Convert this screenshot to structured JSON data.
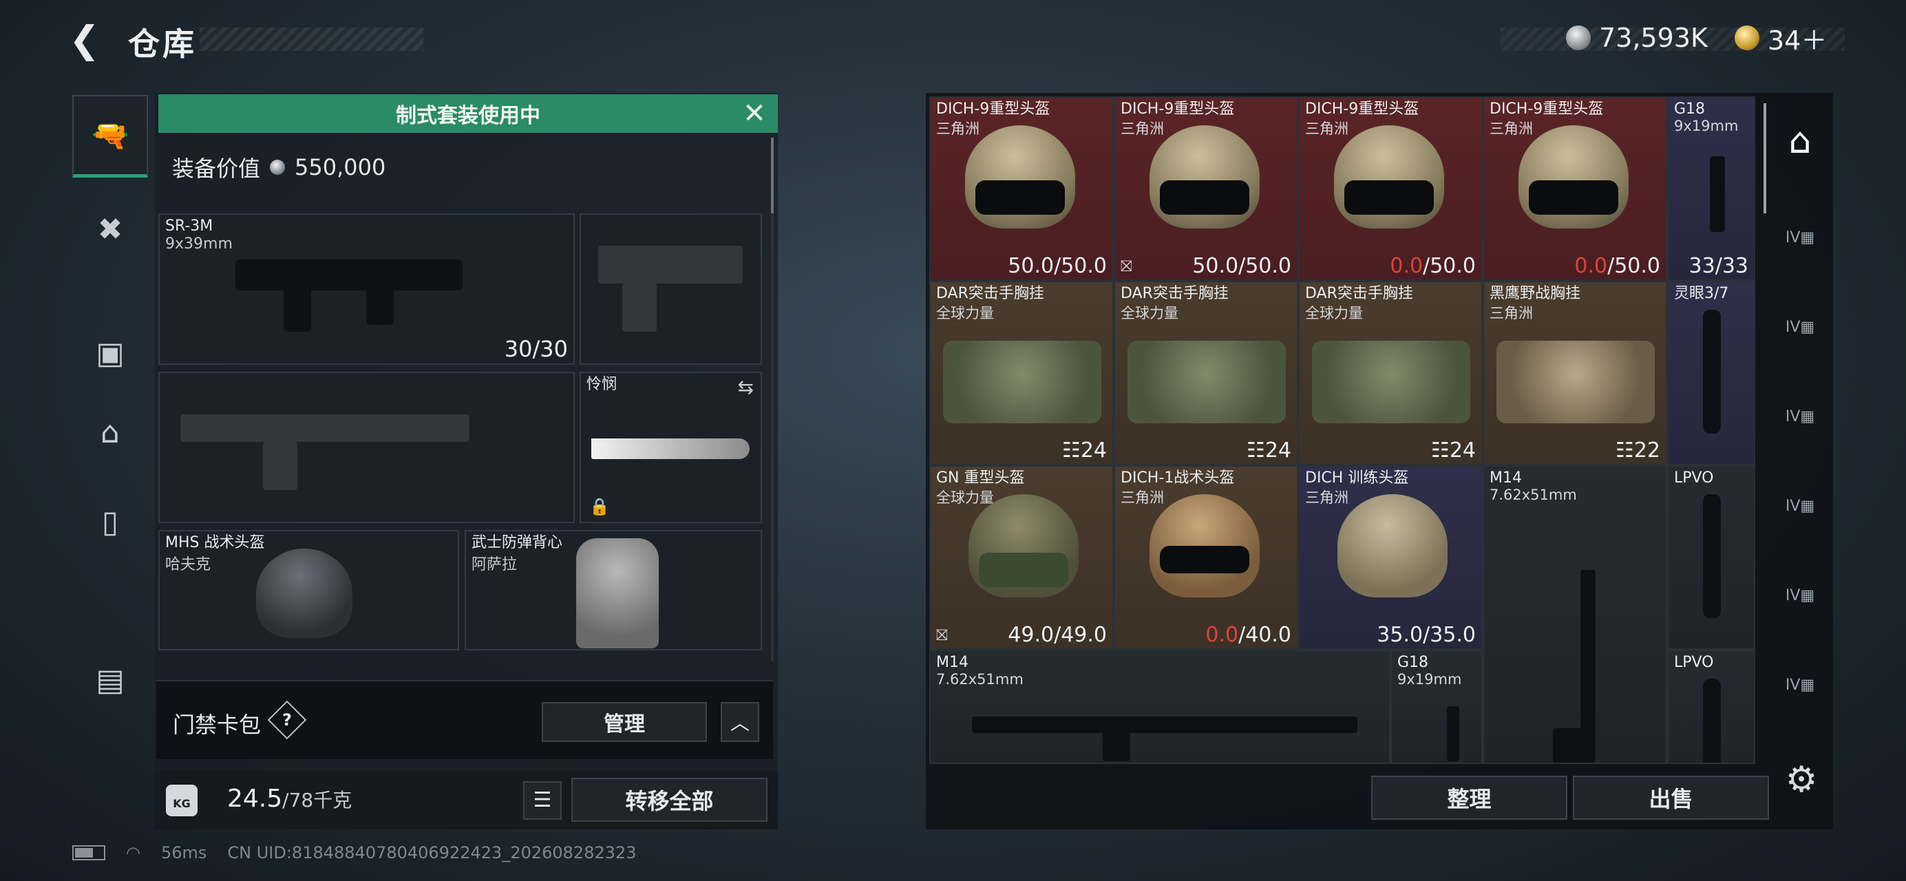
{
  "header": {
    "back_icon": "back-arrow-icon",
    "title": "仓库",
    "silver_amount": "73,593K",
    "gold_amount": "34＋"
  },
  "left_rail": {
    "items": [
      "pistol-icon",
      "vest-icon",
      "backpack-icon",
      "bag-icon",
      "case-icon",
      "toolbox-icon"
    ]
  },
  "loadout": {
    "banner_text": "制式套装使用中",
    "value_label": "装备价值",
    "value_amount": "550,000",
    "primary": {
      "name": "SR-3M",
      "caliber": "9x39mm",
      "ammo": "30/30"
    },
    "melee": {
      "name": "怜悯"
    },
    "helmet": {
      "name": "MHS 战术头盔",
      "maker": "哈夫克"
    },
    "armor": {
      "name": "武士防弹背心",
      "maker": "阿萨拉"
    },
    "keycard_label": "门禁卡包",
    "help_label": "?",
    "manage_label": "管理",
    "collapse_label": "︿"
  },
  "weight": {
    "icon_label": "KG",
    "current": "24.5",
    "max": "/78千克"
  },
  "actions": {
    "list_icon": "☰",
    "transfer_all": "转移全部",
    "sort": "整理",
    "sell": "出售"
  },
  "status_bar": {
    "ping": "56ms",
    "uid": "CN UID:8184884078040692​2423_202608282323"
  },
  "stash": {
    "cells": [
      {
        "name": "DICH-9重型头盔",
        "maker": "三角洲",
        "dur_cur": "50.0",
        "dur_max": "/50.0",
        "low": false,
        "nobind": false
      },
      {
        "name": "DICH-9重型头盔",
        "maker": "三角洲",
        "dur_cur": "50.0",
        "dur_max": "/50.0",
        "low": false,
        "nobind": true
      },
      {
        "name": "DICH-9重型头盔",
        "maker": "三角洲",
        "dur_cur": "0.0",
        "dur_max": "/50.0",
        "low": true,
        "nobind": false
      },
      {
        "name": "DICH-9重型头盔",
        "maker": "三角洲",
        "dur_cur": "0.0",
        "dur_max": "/50.0",
        "low": true,
        "nobind": false
      },
      {
        "name": "G18",
        "maker": "9x19mm",
        "count": "33/33"
      },
      {
        "name": "DAR突击手胸挂",
        "maker": "全球力量",
        "slots": "24"
      },
      {
        "name": "DAR突击手胸挂",
        "maker": "全球力量",
        "slots": "24"
      },
      {
        "name": "DAR突击手胸挂",
        "maker": "全球力量",
        "slots": "24"
      },
      {
        "name": "黑鹰野战胸挂",
        "maker": "三角洲",
        "slots": "22"
      },
      {
        "name": "灵眼3/7",
        "maker": ""
      },
      {
        "name": "GN 重型头盔",
        "maker": "全球力量",
        "dur_cur": "49.0",
        "dur_max": "/49.0",
        "low": false,
        "nobind": true
      },
      {
        "name": "DICH-1战术头盔",
        "maker": "三角洲",
        "dur_cur": "0.0",
        "dur_max": "/40.0",
        "low": true,
        "nobind": false
      },
      {
        "name": "DICH 训练头盔",
        "maker": "三角洲",
        "dur_cur": "35.0",
        "dur_max": "/35.0",
        "low": false,
        "nobind": false
      },
      {
        "name": "M14",
        "maker": "7.62x51mm"
      },
      {
        "name": "LPVO",
        "maker": ""
      },
      {
        "name": "M14",
        "maker": "7.62x51mm"
      },
      {
        "name": "G18",
        "maker": "9x19mm"
      },
      {
        "name": "LPVO",
        "maker": ""
      }
    ]
  },
  "right_rail": {
    "active_icon": "stash-home-icon",
    "tiers": [
      "IV",
      "IV",
      "IV",
      "IV",
      "IV",
      "IV"
    ]
  },
  "colors": {
    "banner": "#2a8b67",
    "red_cell": "#5a2426",
    "brown_cell": "#4a3c2e",
    "purple_cell": "#2f2f4a",
    "low_durability": "#e0403b"
  }
}
